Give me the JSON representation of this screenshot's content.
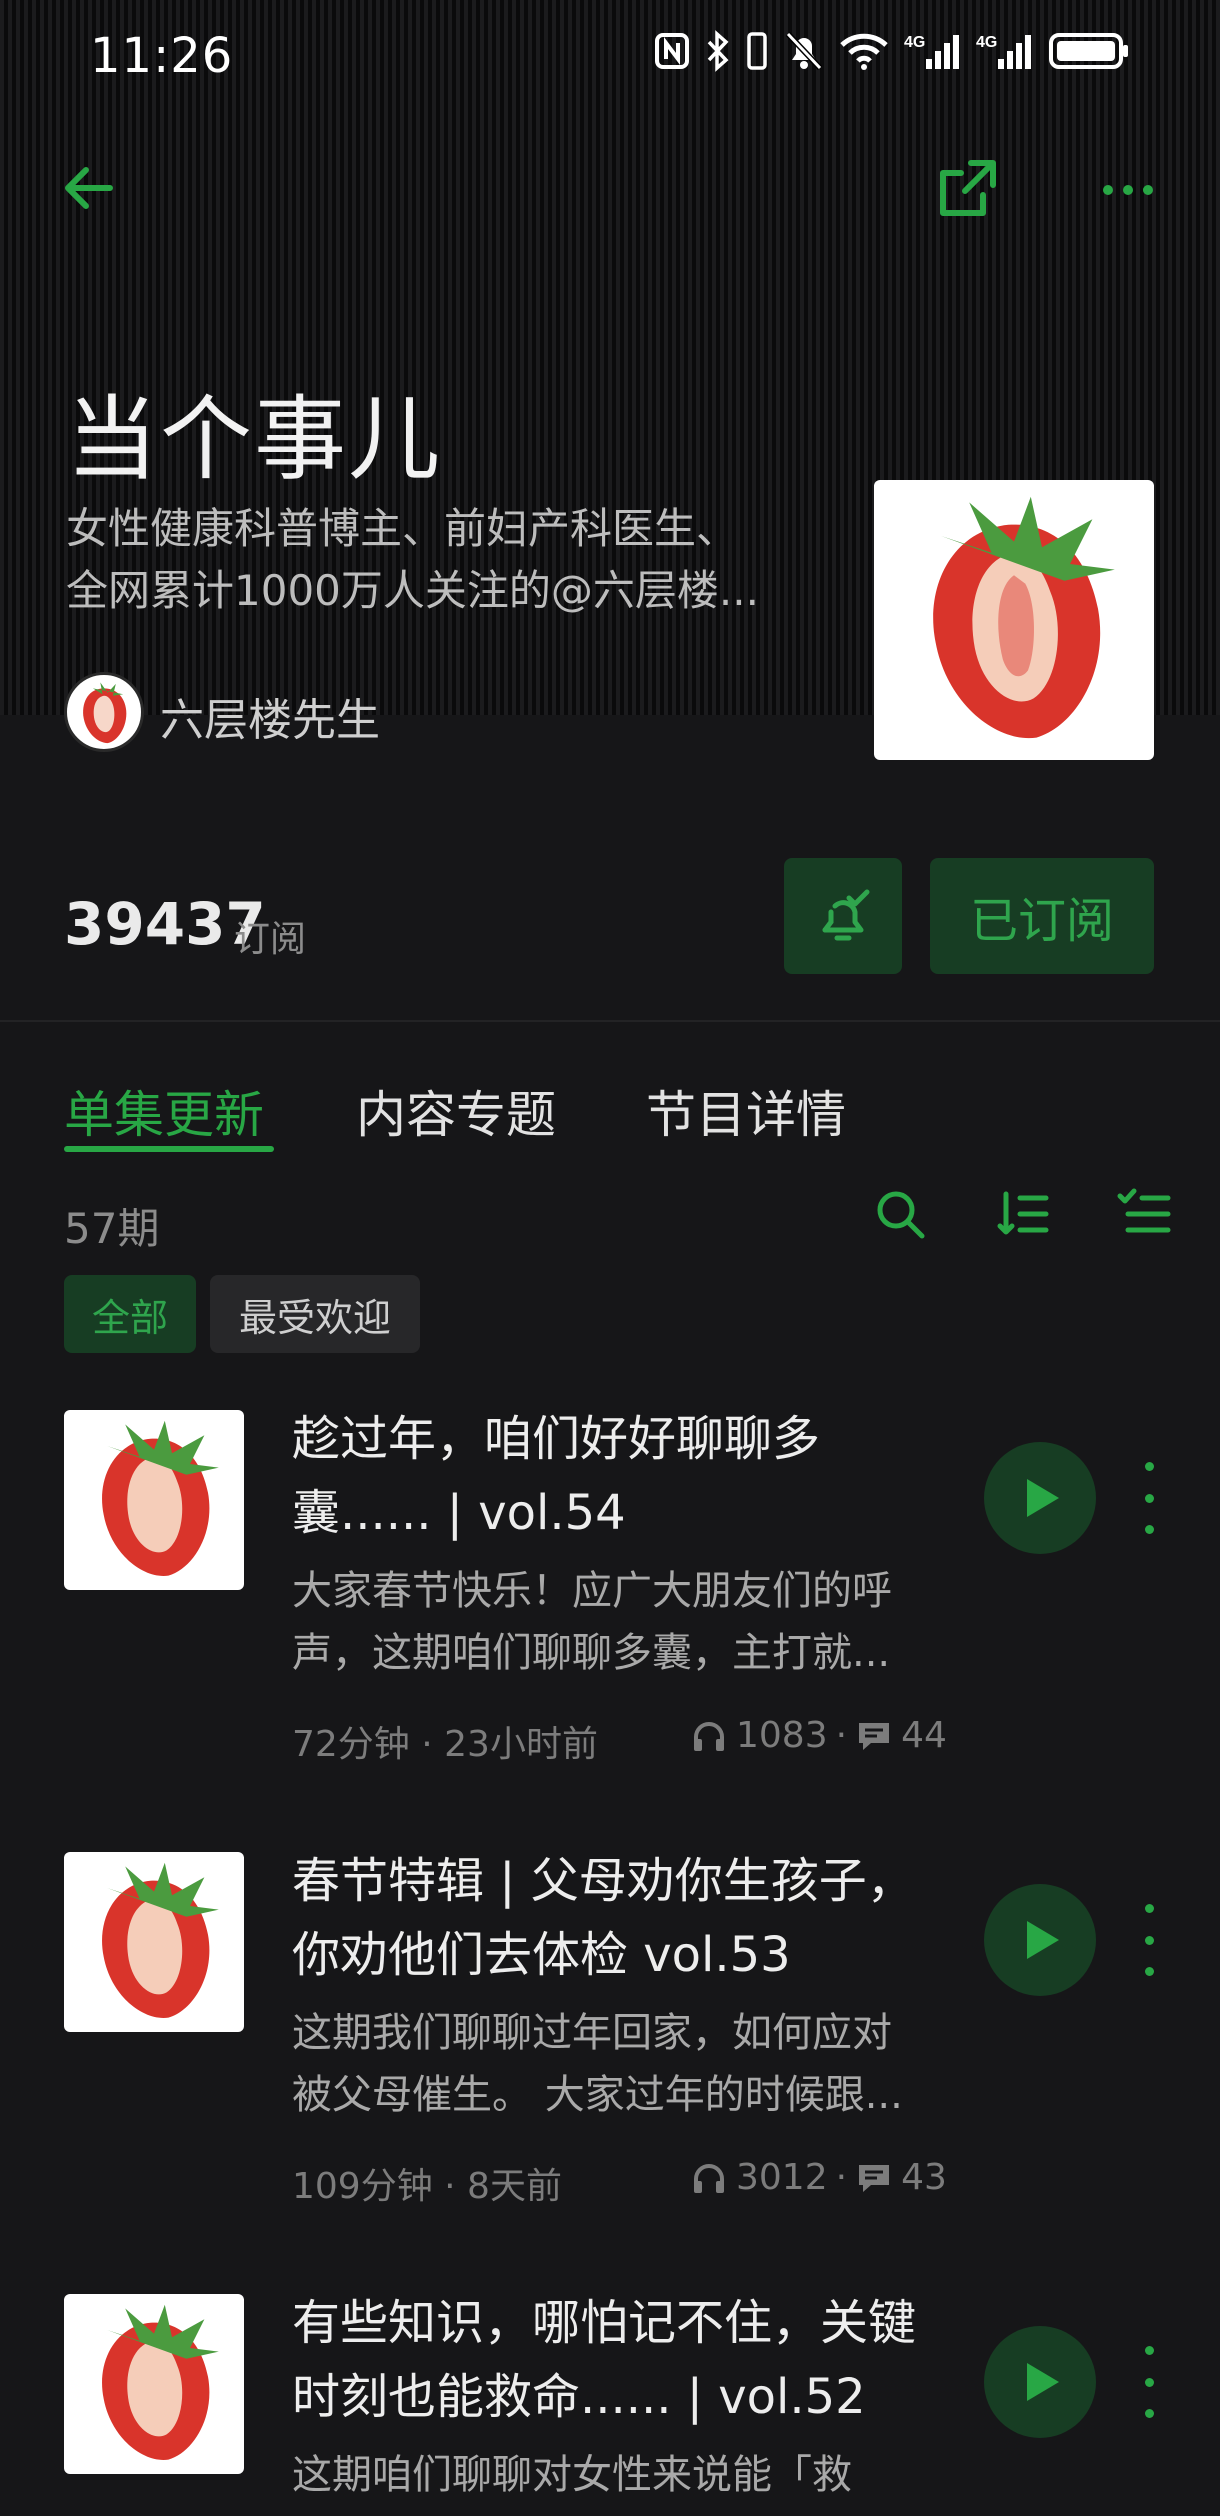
{
  "status_bar": {
    "time": "11:26",
    "icons": [
      "nfc-icon",
      "bluetooth-icon",
      "vibrate-icon",
      "mute-bell-icon",
      "wifi-icon",
      "signal-4g-icon",
      "signal-4g-icon",
      "battery-icon"
    ]
  },
  "nav": {
    "back_icon": "arrow-left-icon",
    "share_icon": "share-external-icon",
    "more_icon": "more-horizontal-icon"
  },
  "podcast": {
    "title": "当个事儿",
    "description_line1": "女性健康科普博主、前妇产科医生、",
    "description_line2": "全网累计1000万人关注的@六层楼...",
    "author": "六层楼先生",
    "subscriber_count": "39437",
    "subscriber_label": "订阅",
    "subscribed_label": "已订阅"
  },
  "tabs": [
    {
      "label": "单集更新",
      "active": true
    },
    {
      "label": "内容专题",
      "active": false
    },
    {
      "label": "节目详情",
      "active": false
    }
  ],
  "episode_count": "57期",
  "filters": [
    "全部",
    "最受欢迎"
  ],
  "episodes": [
    {
      "title_line1": "趁过年，咱们好好聊聊多",
      "title_line2": "囊...... | vol.54",
      "desc_line1": "大家春节快乐！应广大朋友们的呼",
      "desc_line2": "声，这期咱们聊聊多囊，主打就...",
      "meta": "72分钟 · 23小时前",
      "plays": "1083",
      "comments": "44"
    },
    {
      "title_line1": "春节特辑 | 父母劝你生孩子，",
      "title_line2": "你劝他们去体检 vol.53",
      "desc_line1": "这期我们聊聊过年回家，如何应对",
      "desc_line2": "被父母催生。 大家过年的时候跟...",
      "meta": "109分钟 · 8天前",
      "plays": "3012",
      "comments": "43"
    },
    {
      "title_line1": "有些知识，哪怕记不住，关键",
      "title_line2": "时刻也能救命...... | vol.52",
      "desc_line1": "这期咱们聊聊对女性来说能「救",
      "desc_line2": "",
      "meta": "",
      "plays": "",
      "comments": ""
    }
  ],
  "colors": {
    "accent": "#28a745",
    "accent_bg": "#173d23",
    "background": "#161618"
  }
}
